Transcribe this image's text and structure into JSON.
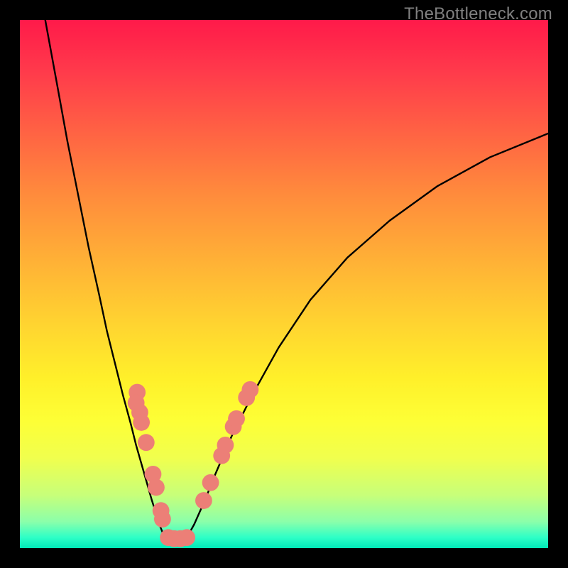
{
  "watermark": "TheBottleneck.com",
  "chart_data": {
    "type": "line",
    "title": "",
    "xlabel": "",
    "ylabel": "",
    "xlim": [
      0,
      100
    ],
    "ylim": [
      0,
      100
    ],
    "grid": false,
    "legend": false,
    "series": [
      {
        "name": "left-curve",
        "color": "#000000",
        "x": [
          4.8,
          7,
          9,
          11,
          13,
          15,
          16.5,
          18,
          19.5,
          21,
          22,
          23,
          24,
          25,
          25.8,
          26.4,
          27,
          27.6
        ],
        "y": [
          100,
          88,
          77,
          67,
          57,
          48,
          41,
          35,
          29,
          23.5,
          19.5,
          16,
          12.5,
          9,
          6.5,
          4.5,
          3,
          2
        ]
      },
      {
        "name": "trough",
        "color": "#000000",
        "x": [
          27.6,
          28.3,
          29.5,
          30.7,
          31.6
        ],
        "y": [
          2,
          1.7,
          1.6,
          1.7,
          2
        ]
      },
      {
        "name": "right-curve",
        "color": "#000000",
        "x": [
          31.6,
          33,
          35,
          37,
          40,
          44,
          49,
          55,
          62,
          70,
          79,
          89,
          100
        ],
        "y": [
          2,
          4.5,
          9,
          14,
          21,
          29,
          38,
          47,
          55,
          62,
          68.5,
          74,
          78.5
        ]
      }
    ],
    "markers": [
      {
        "name": "left-dots",
        "color": "#ec7f77",
        "radius_percent": 1.6,
        "points": [
          {
            "x": 22.2,
            "y": 29.5
          },
          {
            "x": 22.0,
            "y": 27.5
          },
          {
            "x": 22.7,
            "y": 25.7
          },
          {
            "x": 23.0,
            "y": 23.8
          },
          {
            "x": 23.9,
            "y": 20.0
          },
          {
            "x": 25.2,
            "y": 14.0
          },
          {
            "x": 25.8,
            "y": 11.5
          },
          {
            "x": 26.7,
            "y": 7.1
          },
          {
            "x": 27.0,
            "y": 5.5
          }
        ]
      },
      {
        "name": "trough-dots",
        "color": "#ec7f77",
        "radius_percent": 1.6,
        "points": [
          {
            "x": 28.1,
            "y": 2.0
          },
          {
            "x": 29.2,
            "y": 1.8
          },
          {
            "x": 30.4,
            "y": 1.8
          },
          {
            "x": 31.6,
            "y": 2.0
          }
        ]
      },
      {
        "name": "right-dots",
        "color": "#ec7f77",
        "radius_percent": 1.6,
        "points": [
          {
            "x": 34.8,
            "y": 9.0
          },
          {
            "x": 36.1,
            "y": 12.4
          },
          {
            "x": 38.2,
            "y": 17.5
          },
          {
            "x": 38.9,
            "y": 19.5
          },
          {
            "x": 40.4,
            "y": 23.0
          },
          {
            "x": 41.0,
            "y": 24.5
          },
          {
            "x": 42.9,
            "y": 28.5
          },
          {
            "x": 43.6,
            "y": 30.0
          }
        ]
      }
    ]
  }
}
